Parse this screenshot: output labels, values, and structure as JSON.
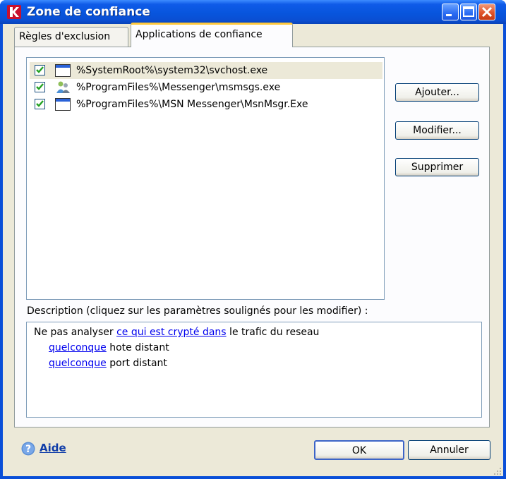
{
  "window": {
    "title": "Zone de confiance",
    "app_icon": "kaspersky-k-icon",
    "controls": [
      "minimize-icon",
      "maximize-icon",
      "close-icon"
    ]
  },
  "tabs": [
    {
      "label": "Règles d'exclusion",
      "active": false
    },
    {
      "label": "Applications de confiance",
      "active": true
    }
  ],
  "applications": [
    {
      "checked": true,
      "icon": "window-app-icon",
      "path": "%SystemRoot%\\system32\\svchost.exe",
      "selected": true
    },
    {
      "checked": true,
      "icon": "messenger-users-icon",
      "path": "%ProgramFiles%\\Messenger\\msmsgs.exe",
      "selected": false
    },
    {
      "checked": true,
      "icon": "window-app-icon",
      "path": "%ProgramFiles%\\MSN Messenger\\MsnMsgr.Exe",
      "selected": false
    }
  ],
  "buttons": {
    "add": "Ajouter...",
    "modify": "Modifier...",
    "delete": "Supprimer",
    "ok": "OK",
    "cancel": "Annuler"
  },
  "description": {
    "label": "Description (cliquez sur les paramètres soulignés pour les modifier) :",
    "line1_prefix": "Ne pas analyser ",
    "line1_link": "ce qui est crypté dans",
    "line1_suffix": " le trafic du reseau",
    "line2_link": "quelconque",
    "line2_suffix": " hote distant",
    "line3_link": "quelconque",
    "line3_suffix": " port distant"
  },
  "help": {
    "label": "Aide",
    "icon": "help-question-icon"
  },
  "colors": {
    "titlebar": "#0855dd",
    "link": "#0000ee",
    "tab_highlight": "#ffc83c",
    "face": "#ece9d8"
  }
}
